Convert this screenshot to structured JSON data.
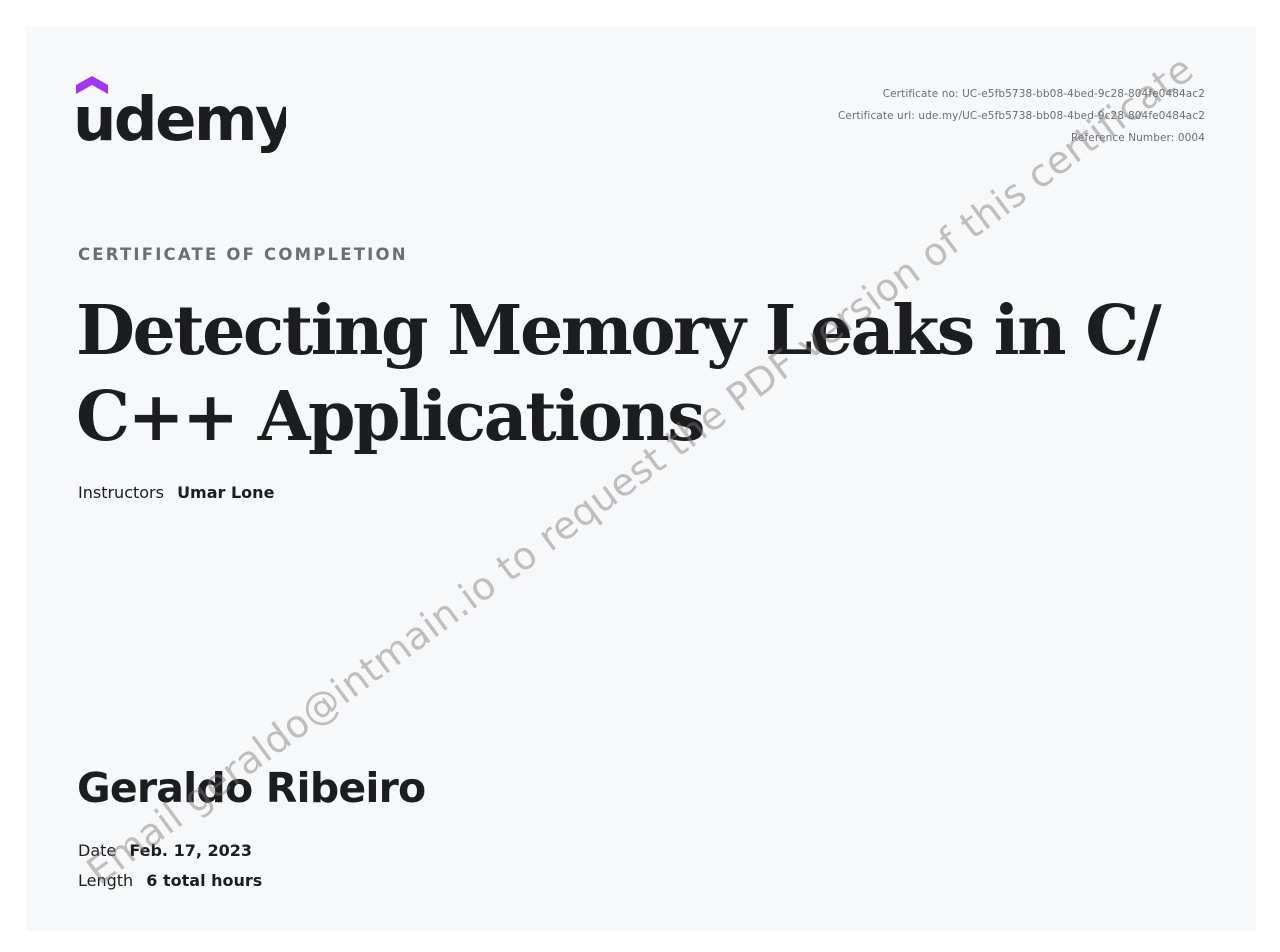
{
  "logo": {
    "text": "udemy",
    "icon": "udemy-logo-icon",
    "colors": {
      "accent": "#a435f0",
      "text": "#1c1d1f"
    }
  },
  "meta": {
    "certificate_no": "Certificate no: UC-e5fb5738-bb08-4bed-9c28-804fe0484ac2",
    "certificate_url": "Certificate url: ude.my/UC-e5fb5738-bb08-4bed-9c28-804fe0484ac2",
    "reference_number": "Reference Number: 0004"
  },
  "certificate": {
    "kicker": "CERTIFICATE OF COMPLETION",
    "title_line1": "Detecting Memory Leaks in C/",
    "title_line2": "C++ Applications",
    "instructors_label": "Instructors",
    "instructors_value": "Umar Lone",
    "recipient": "Geraldo Ribeiro",
    "date_label": "Date",
    "date_value": "Feb. 17, 2023",
    "length_label": "Length",
    "length_value": "6 total hours"
  },
  "watermark": {
    "text": "Email geraldo@intmain.io to request the PDF version of this certificate"
  },
  "colors": {
    "background": "#f7f8fa",
    "heading": "#1c1d1f",
    "muted": "#6a6f73"
  }
}
